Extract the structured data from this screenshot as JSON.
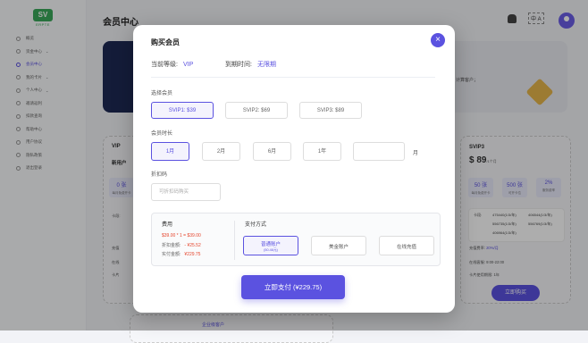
{
  "brand": {
    "logo_mark": "SV",
    "logo_text": "ERPTE"
  },
  "sidebar": {
    "items": [
      {
        "label": "概览"
      },
      {
        "label": "资金中心",
        "has_chevron": true
      },
      {
        "label": "会员中心",
        "active": true
      },
      {
        "label": "我的卡片",
        "has_chevron": true
      },
      {
        "label": "个人中心",
        "has_chevron": true
      },
      {
        "label": "邀请返利"
      },
      {
        "label": "扣款查询"
      },
      {
        "label": "帮助中心"
      },
      {
        "label": "用户协议"
      },
      {
        "label": "隐私政策"
      },
      {
        "label": "退出登录"
      }
    ]
  },
  "header": {
    "title": "会员中心",
    "lang_label": "中 A",
    "icons": [
      "bell-icon",
      "translate-icon",
      "avatar-icon"
    ]
  },
  "banner": {
    "text": "计算客户；"
  },
  "left_plan": {
    "name": "VIP",
    "subtitle": "新用户 ",
    "stat_value": "0 张",
    "stat_label": "每月免费开卡",
    "card_label": "卡段:",
    "features": [
      "充值",
      "在线",
      "卡片"
    ]
  },
  "right_plan": {
    "name": "SVIP3",
    "price": "$ 89",
    "unit": "/1个月",
    "stats": [
      {
        "value": "50 张",
        "label": "每月免费开卡"
      },
      {
        "value": "500 张",
        "label": "可开卡位"
      },
      {
        "value": "2%",
        "label": "服务费率"
      }
    ],
    "card_label": "卡段:",
    "cards": [
      "475440(1/3/年)",
      "406544(1/3/年)",
      "556735(1/3/年)",
      "556769(1/3/年)",
      "406964(1/3/年)"
    ],
    "features": [
      {
        "label": "充值费率:",
        "value": "20%/月"
      },
      {
        "label": "在线客服:",
        "value": "9:00-22:00"
      },
      {
        "label": "卡片使用期限:",
        "value": "1年"
      }
    ],
    "buy_label": "立即购买"
  },
  "enterprise": {
    "label": "企业级客户"
  },
  "modal": {
    "title": "购买会员",
    "close": "×",
    "current_level_label": "当前等级:",
    "current_level_value": "VIP",
    "expire_label": "到期时间:",
    "expire_value": "无限期",
    "select_member_label": "选择会员",
    "member_options": [
      {
        "label": "SVIP1: $39",
        "selected": true
      },
      {
        "label": "SVIP2: $69",
        "selected": false
      },
      {
        "label": "SVIP3: $89",
        "selected": false
      }
    ],
    "duration_label": "会员时长",
    "duration_options": [
      {
        "label": "1月",
        "selected": true
      },
      {
        "label": "2月",
        "selected": false
      },
      {
        "label": "6月",
        "selected": false
      },
      {
        "label": "1年",
        "selected": false
      }
    ],
    "custom_months_value": "",
    "month_unit": "月",
    "coupon_label": "折扣码",
    "coupon_placeholder": "可折扣码购买",
    "fee": {
      "title": "费用",
      "formula": "$39.00 * 1 = $39.00",
      "discount_label": "折扣金额:",
      "discount_value": "- ¥25.52",
      "paid_label": "实付金额:",
      "paid_value": "¥229.75"
    },
    "payment": {
      "title": "支付方式",
      "options": [
        {
          "label": "普通账户",
          "sub": "(50.46元)",
          "selected": true
        },
        {
          "label": "美金账户",
          "sub": "",
          "selected": false
        },
        {
          "label": "在线充值",
          "sub": "",
          "selected": false
        }
      ]
    },
    "pay_button": "立即支付 (¥229.75)"
  },
  "colors": {
    "accent": "#5b52e0",
    "danger": "#e5442b",
    "brand": "#3aa85a"
  }
}
